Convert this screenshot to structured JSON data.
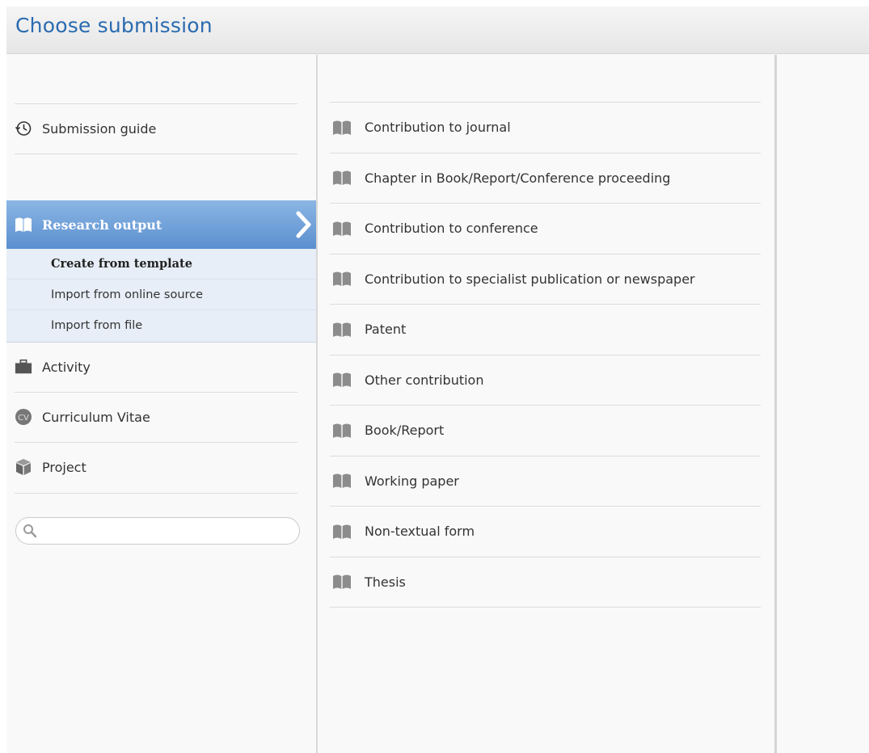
{
  "header": {
    "title": "Choose submission"
  },
  "left": {
    "guide": {
      "label": "Submission guide",
      "icon": "history-icon"
    },
    "research_output": {
      "label": "Research output",
      "icon": "book-icon",
      "sub_items": [
        {
          "label": "Create from template",
          "active": true
        },
        {
          "label": "Import from online source",
          "active": false
        },
        {
          "label": "Import from file",
          "active": false
        }
      ]
    },
    "items": [
      {
        "label": "Activity",
        "icon": "briefcase-icon"
      },
      {
        "label": "Curriculum Vitae",
        "icon": "cv-icon"
      },
      {
        "label": "Project",
        "icon": "cube-icon"
      }
    ],
    "search": {
      "placeholder": "",
      "value": ""
    }
  },
  "templates": [
    {
      "label": "Contribution to journal"
    },
    {
      "label": "Chapter in Book/Report/Conference proceeding"
    },
    {
      "label": "Contribution to conference"
    },
    {
      "label": "Contribution to specialist publication or newspaper"
    },
    {
      "label": "Patent"
    },
    {
      "label": "Other contribution"
    },
    {
      "label": "Book/Report"
    },
    {
      "label": "Working paper"
    },
    {
      "label": "Non-textual form"
    },
    {
      "label": "Thesis"
    }
  ],
  "colors": {
    "accent": "#2a6bb0",
    "selected_gradient_top": "#8bb6e4",
    "selected_gradient_bottom": "#5b8fcf",
    "submenu_bg": "#e7eef7",
    "icon_gray": "#8c8c8c"
  }
}
